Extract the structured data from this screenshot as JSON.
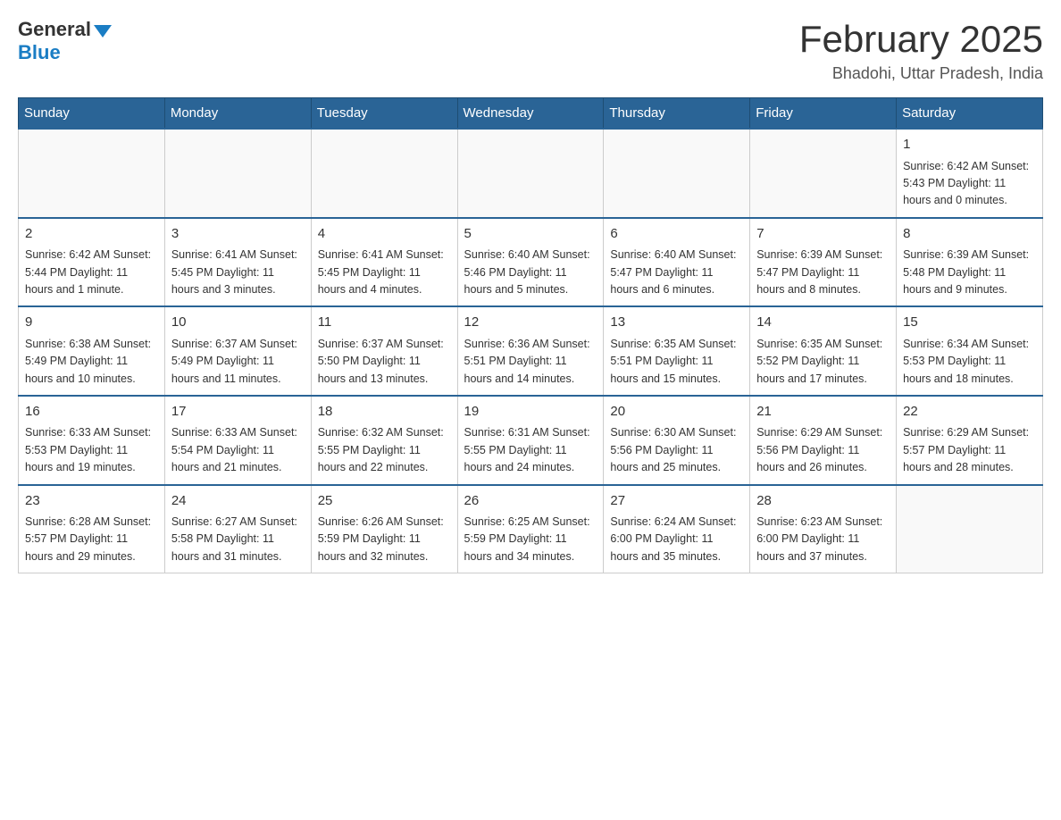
{
  "logo": {
    "general": "General",
    "blue": "Blue"
  },
  "header": {
    "month_title": "February 2025",
    "subtitle": "Bhadohi, Uttar Pradesh, India"
  },
  "days_of_week": [
    "Sunday",
    "Monday",
    "Tuesday",
    "Wednesday",
    "Thursday",
    "Friday",
    "Saturday"
  ],
  "weeks": [
    {
      "days": [
        {
          "num": "",
          "info": ""
        },
        {
          "num": "",
          "info": ""
        },
        {
          "num": "",
          "info": ""
        },
        {
          "num": "",
          "info": ""
        },
        {
          "num": "",
          "info": ""
        },
        {
          "num": "",
          "info": ""
        },
        {
          "num": "1",
          "info": "Sunrise: 6:42 AM\nSunset: 5:43 PM\nDaylight: 11 hours and 0 minutes."
        }
      ]
    },
    {
      "days": [
        {
          "num": "2",
          "info": "Sunrise: 6:42 AM\nSunset: 5:44 PM\nDaylight: 11 hours and 1 minute."
        },
        {
          "num": "3",
          "info": "Sunrise: 6:41 AM\nSunset: 5:45 PM\nDaylight: 11 hours and 3 minutes."
        },
        {
          "num": "4",
          "info": "Sunrise: 6:41 AM\nSunset: 5:45 PM\nDaylight: 11 hours and 4 minutes."
        },
        {
          "num": "5",
          "info": "Sunrise: 6:40 AM\nSunset: 5:46 PM\nDaylight: 11 hours and 5 minutes."
        },
        {
          "num": "6",
          "info": "Sunrise: 6:40 AM\nSunset: 5:47 PM\nDaylight: 11 hours and 6 minutes."
        },
        {
          "num": "7",
          "info": "Sunrise: 6:39 AM\nSunset: 5:47 PM\nDaylight: 11 hours and 8 minutes."
        },
        {
          "num": "8",
          "info": "Sunrise: 6:39 AM\nSunset: 5:48 PM\nDaylight: 11 hours and 9 minutes."
        }
      ]
    },
    {
      "days": [
        {
          "num": "9",
          "info": "Sunrise: 6:38 AM\nSunset: 5:49 PM\nDaylight: 11 hours and 10 minutes."
        },
        {
          "num": "10",
          "info": "Sunrise: 6:37 AM\nSunset: 5:49 PM\nDaylight: 11 hours and 11 minutes."
        },
        {
          "num": "11",
          "info": "Sunrise: 6:37 AM\nSunset: 5:50 PM\nDaylight: 11 hours and 13 minutes."
        },
        {
          "num": "12",
          "info": "Sunrise: 6:36 AM\nSunset: 5:51 PM\nDaylight: 11 hours and 14 minutes."
        },
        {
          "num": "13",
          "info": "Sunrise: 6:35 AM\nSunset: 5:51 PM\nDaylight: 11 hours and 15 minutes."
        },
        {
          "num": "14",
          "info": "Sunrise: 6:35 AM\nSunset: 5:52 PM\nDaylight: 11 hours and 17 minutes."
        },
        {
          "num": "15",
          "info": "Sunrise: 6:34 AM\nSunset: 5:53 PM\nDaylight: 11 hours and 18 minutes."
        }
      ]
    },
    {
      "days": [
        {
          "num": "16",
          "info": "Sunrise: 6:33 AM\nSunset: 5:53 PM\nDaylight: 11 hours and 19 minutes."
        },
        {
          "num": "17",
          "info": "Sunrise: 6:33 AM\nSunset: 5:54 PM\nDaylight: 11 hours and 21 minutes."
        },
        {
          "num": "18",
          "info": "Sunrise: 6:32 AM\nSunset: 5:55 PM\nDaylight: 11 hours and 22 minutes."
        },
        {
          "num": "19",
          "info": "Sunrise: 6:31 AM\nSunset: 5:55 PM\nDaylight: 11 hours and 24 minutes."
        },
        {
          "num": "20",
          "info": "Sunrise: 6:30 AM\nSunset: 5:56 PM\nDaylight: 11 hours and 25 minutes."
        },
        {
          "num": "21",
          "info": "Sunrise: 6:29 AM\nSunset: 5:56 PM\nDaylight: 11 hours and 26 minutes."
        },
        {
          "num": "22",
          "info": "Sunrise: 6:29 AM\nSunset: 5:57 PM\nDaylight: 11 hours and 28 minutes."
        }
      ]
    },
    {
      "days": [
        {
          "num": "23",
          "info": "Sunrise: 6:28 AM\nSunset: 5:57 PM\nDaylight: 11 hours and 29 minutes."
        },
        {
          "num": "24",
          "info": "Sunrise: 6:27 AM\nSunset: 5:58 PM\nDaylight: 11 hours and 31 minutes."
        },
        {
          "num": "25",
          "info": "Sunrise: 6:26 AM\nSunset: 5:59 PM\nDaylight: 11 hours and 32 minutes."
        },
        {
          "num": "26",
          "info": "Sunrise: 6:25 AM\nSunset: 5:59 PM\nDaylight: 11 hours and 34 minutes."
        },
        {
          "num": "27",
          "info": "Sunrise: 6:24 AM\nSunset: 6:00 PM\nDaylight: 11 hours and 35 minutes."
        },
        {
          "num": "28",
          "info": "Sunrise: 6:23 AM\nSunset: 6:00 PM\nDaylight: 11 hours and 37 minutes."
        },
        {
          "num": "",
          "info": ""
        }
      ]
    }
  ]
}
